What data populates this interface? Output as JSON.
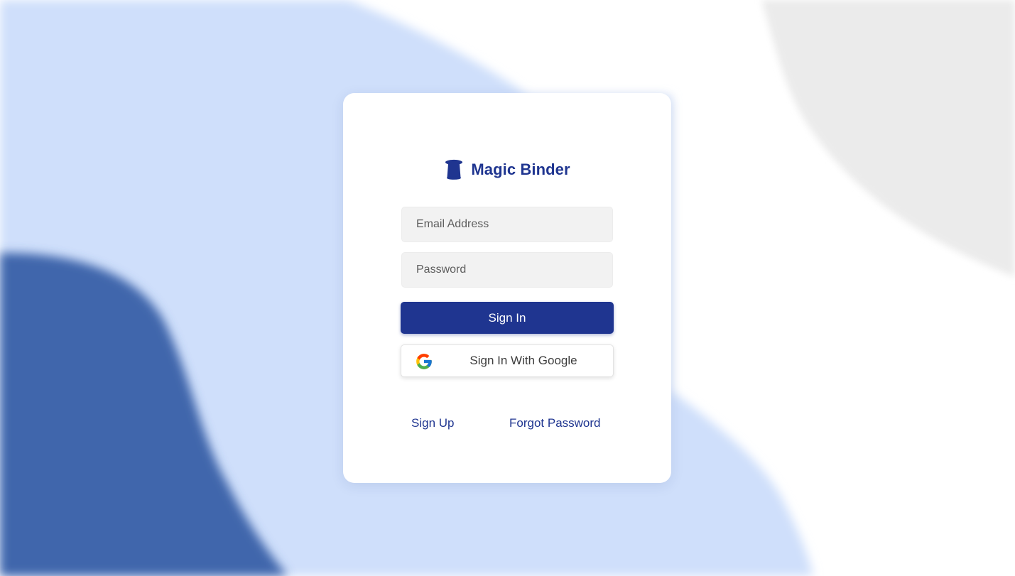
{
  "brand": {
    "name": "Magic Binder",
    "icon": "hat-icon"
  },
  "login": {
    "email_placeholder": "Email Address",
    "password_placeholder": "Password",
    "signin_label": "Sign In",
    "google_label": "Sign In With Google",
    "google_icon": "google-icon"
  },
  "links": {
    "signup": "Sign Up",
    "forgot": "Forgot Password"
  },
  "colors": {
    "primary": "#1f3590",
    "background_light_blue": "#cfdffb",
    "background_dark_blue": "#4066ac",
    "background_gray": "#ebebeb",
    "input_bg": "#f2f2f2"
  }
}
